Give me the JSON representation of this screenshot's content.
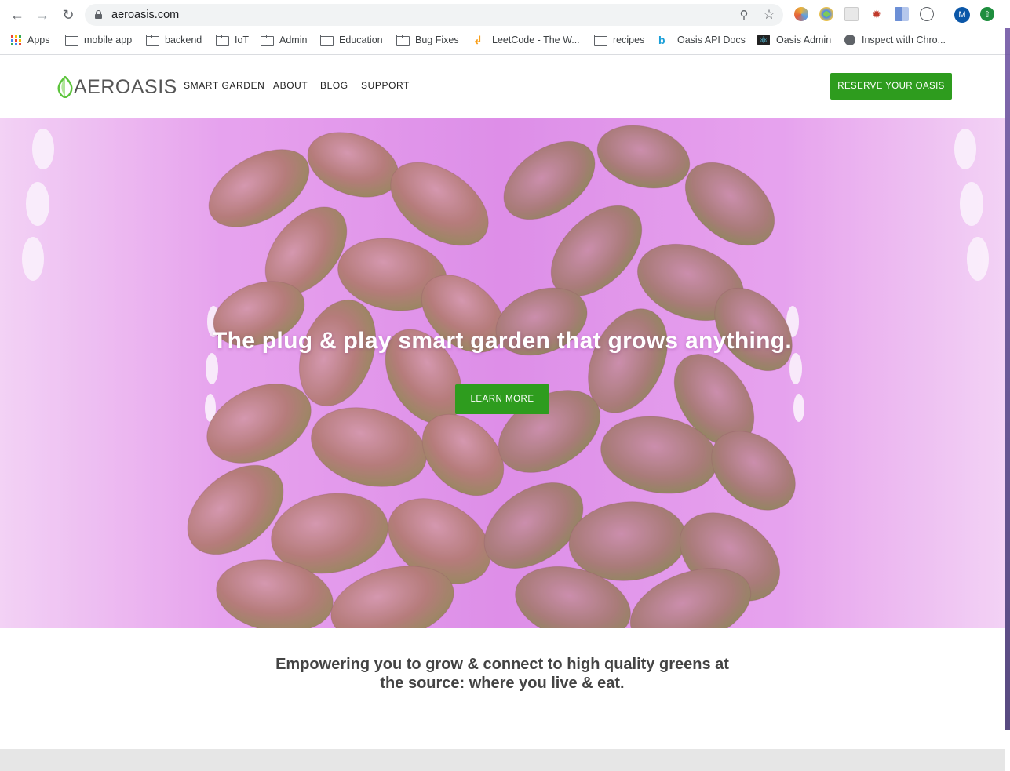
{
  "browser": {
    "url": "aeroasis.com",
    "icons": {
      "back": "arrow-left-icon",
      "forward": "arrow-right-icon",
      "reload": "reload-icon",
      "lock": "lock-icon",
      "zoom": "zoom-icon",
      "star": "star-icon"
    },
    "profile_initial": "M",
    "bookmarks": [
      {
        "label": "Apps",
        "icon": "apps-icon"
      },
      {
        "label": "mobile app",
        "icon": "folder-icon"
      },
      {
        "label": "backend",
        "icon": "folder-icon"
      },
      {
        "label": "IoT",
        "icon": "folder-icon"
      },
      {
        "label": "Admin",
        "icon": "folder-icon"
      },
      {
        "label": "Education",
        "icon": "folder-icon"
      },
      {
        "label": "Bug Fixes",
        "icon": "folder-icon"
      },
      {
        "label": "LeetCode - The W...",
        "icon": "leetcode-icon"
      },
      {
        "label": "recipes",
        "icon": "folder-icon"
      },
      {
        "label": "Oasis API Docs",
        "icon": "docs-icon"
      },
      {
        "label": "Oasis Admin",
        "icon": "react-icon"
      },
      {
        "label": "Inspect with Chro...",
        "icon": "globe-icon"
      }
    ]
  },
  "site": {
    "logo_text": "AEROASIS",
    "nav": [
      "SMART GARDEN",
      "ABOUT",
      "BLOG",
      "SUPPORT"
    ],
    "cta": "RESERVE YOUR OASIS",
    "hero_title": "The plug & play smart garden that grows anything.",
    "hero_button": "LEARN MORE",
    "tagline_line1": "Empowering you to grow & connect to high quality greens at",
    "tagline_line2": "the source: where you live & eat.",
    "colors": {
      "accent_green": "#2e9c1e",
      "hero_pink": "#e59cf0"
    }
  }
}
